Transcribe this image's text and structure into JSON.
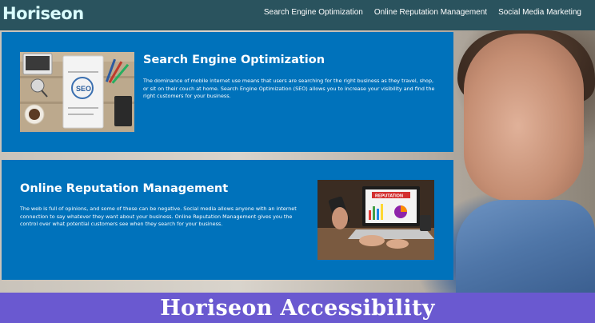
{
  "header": {
    "logo": "Horiseon",
    "nav": [
      {
        "label": "Search Engine Optimization"
      },
      {
        "label": "Online Reputation Management"
      },
      {
        "label": "Social Media Marketing"
      }
    ]
  },
  "main": {
    "cards": [
      {
        "title": "Search Engine Optimization",
        "body": "The dominance of mobile internet use means that users are searching for the right business as they travel, shop, or sit on their couch at home. Search Engine Optimization (SEO) allows you to increase your visibility and find the right customers for your business.",
        "image_label": "SEO"
      },
      {
        "title": "Online Reputation Management",
        "body": "The web is full of opinions, and some of these can be negative. Social media allows anyone with an internet connection to say whatever they want about your business. Online Reputation Management gives you the control over what potential customers see when they search for your business.",
        "image_label": "REPUTATION"
      }
    ]
  },
  "footer_banner": {
    "text": "Horiseon Accessibility"
  },
  "colors": {
    "header_bg": "#2a535e",
    "logo": "#d9fcfc",
    "card_bg": "#0072bb",
    "banner_bg": "#6a59d0"
  }
}
